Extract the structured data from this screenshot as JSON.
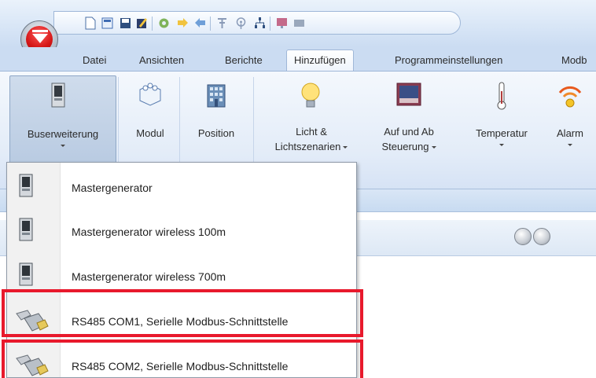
{
  "ribbon_tabs": [
    {
      "label": "Datei",
      "icon": "none"
    },
    {
      "label": "Ansichten"
    },
    {
      "label": "Berichte"
    },
    {
      "label": "Hinzufügen",
      "active": true
    },
    {
      "label": "Programmeinstellungen"
    },
    {
      "label": "Modb"
    }
  ],
  "quick_access_icons": [
    "new-document-icon",
    "open-icon",
    "save-icon",
    "edit-icon",
    "settings-gear-icon",
    "import-icon",
    "export-icon",
    "filter-icon",
    "radio-icon",
    "network-icon",
    "monitor-icon",
    "display-icon"
  ],
  "ribbon_buttons": [
    {
      "label": "Buserweiterung",
      "icon": "bus-extension-icon",
      "has_dropdown": true,
      "pressed": true
    },
    {
      "label": "Modul",
      "icon": "module-icon",
      "has_dropdown": false
    },
    {
      "label": "Position",
      "icon": "building-icon",
      "has_dropdown": false
    },
    {
      "label_line1": "Licht &",
      "label_line2": "Lichtszenarien",
      "icon": "light-bulb-icon",
      "has_dropdown": true
    },
    {
      "label_line1": "Auf und Ab",
      "label_line2": "Steuerung",
      "icon": "blinds-icon",
      "has_dropdown": true
    },
    {
      "label": "Temperatur",
      "icon": "thermometer-icon",
      "has_dropdown": true
    },
    {
      "label": "Alarm",
      "icon": "alarm-icon",
      "has_dropdown": true
    }
  ],
  "dropdown_items": [
    {
      "label": "Mastergenerator",
      "icon": "master-generator-icon"
    },
    {
      "label": "Mastergenerator wireless 100m",
      "icon": "master-generator-icon"
    },
    {
      "label": "Mastergenerator wireless 700m",
      "icon": "master-generator-icon"
    },
    {
      "label": "RS485 COM1, Serielle Modbus-Schnittstelle",
      "icon": "serial-connector-icon",
      "highlighted": true
    },
    {
      "label": "RS485 COM2, Serielle Modbus-Schnittstelle",
      "icon": "serial-connector-icon",
      "highlighted": true
    }
  ],
  "colors": {
    "highlight": "#e8192c",
    "ribbon": "#d7e5f6",
    "brand_red": "#d41616"
  }
}
